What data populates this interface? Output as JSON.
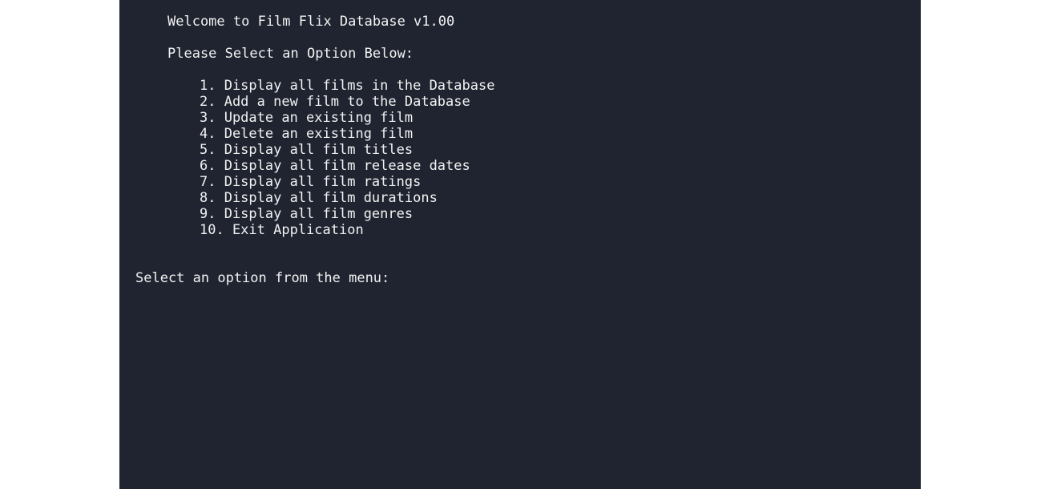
{
  "terminal": {
    "background": "#1f2430",
    "text_color": "#f2f2f2",
    "welcome": "Welcome to Film Flix Database v1.00",
    "select_heading": "Please Select an Option Below:",
    "menu": [
      "1. Display all films in the Database",
      "2. Add a new film to the Database",
      "3. Update an existing film",
      "4. Delete an existing film",
      "5. Display all film titles",
      "6. Display all film release dates",
      "7. Display all film ratings",
      "8. Display all film durations",
      "9. Display all film genres",
      "10. Exit Application"
    ],
    "input_prompt": "Select an option from the menu:",
    "input_value": ""
  }
}
